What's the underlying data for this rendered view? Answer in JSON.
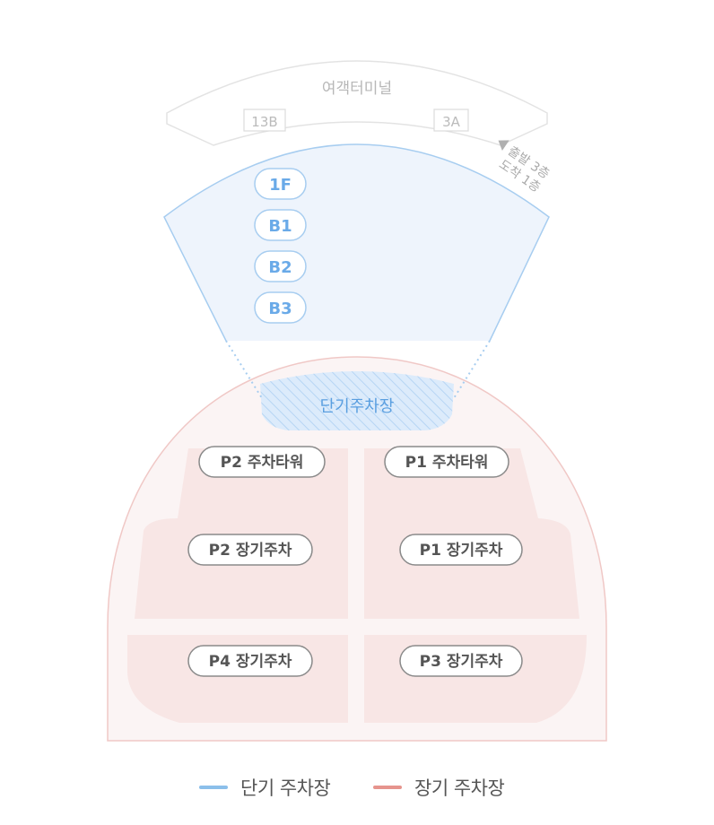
{
  "terminal": {
    "name": "여객터미널",
    "gates": [
      "13B",
      "3A"
    ],
    "direction_lines": [
      "출발 3층",
      "도착 1층"
    ]
  },
  "short_term": {
    "floors": [
      "1F",
      "B1",
      "B2",
      "B3"
    ],
    "label": "단기주차장"
  },
  "long_term": {
    "badges": [
      "P2 주차타워",
      "P1 주차타워",
      "P2 장기주차",
      "P1 장기주차",
      "P4 장기주차",
      "P3 장기주차"
    ]
  },
  "legend": {
    "items": [
      {
        "label": "단기 주차장",
        "color": "#8bbfea"
      },
      {
        "label": "장기 주차장",
        "color": "#e6948d"
      }
    ]
  },
  "colors": {
    "short_fill": "#eef4fc",
    "short_stroke": "#a7cdf0",
    "short_text": "#6aaae8",
    "long_outer_fill": "#fbf4f4",
    "long_outer_stroke": "#f0c8c6",
    "long_block_fill": "#f8e6e5",
    "terminal_fill": "#ffffff",
    "terminal_stroke": "#e3e3e3",
    "terminal_text": "#b7b7b7",
    "badge_stroke": "#8a8a8a",
    "badge_text": "#555555"
  }
}
